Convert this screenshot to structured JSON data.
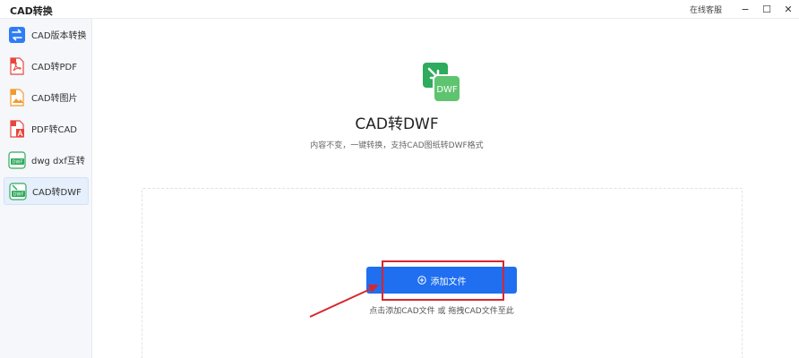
{
  "window": {
    "title": "CAD转换",
    "support_label": "在线客服",
    "minimize_glyph": "−",
    "maximize_glyph": "☐",
    "close_glyph": "✕"
  },
  "sidebar": {
    "items": [
      {
        "label": "CAD版本转换",
        "icon": "swap-icon",
        "color": "#2f7cf6"
      },
      {
        "label": "CAD转PDF",
        "icon": "pdf-file-icon",
        "color": "#e8463c"
      },
      {
        "label": "CAD转图片",
        "icon": "image-file-icon",
        "color": "#f29a2e"
      },
      {
        "label": "PDF转CAD",
        "icon": "pdf-to-cad-icon",
        "color": "#e8463c"
      },
      {
        "label": "dwg dxf互转",
        "icon": "dwf-convert-icon",
        "color": "#2eab5c"
      },
      {
        "label": "CAD转DWF",
        "icon": "dwf-file-icon",
        "color": "#2eab5c"
      }
    ],
    "active_index": 5
  },
  "main": {
    "logo_text": "DWF",
    "title": "CAD转DWF",
    "subtitle": "内容不变，一键转换，支持CAD图纸转DWF格式",
    "add_button_label": "添加文件",
    "hint": "点击添加CAD文件 或 拖拽CAD文件至此"
  },
  "colors": {
    "accent": "#1f6ff0",
    "annotation_red": "#d9252d",
    "dwf_green": "#2eab5c"
  }
}
